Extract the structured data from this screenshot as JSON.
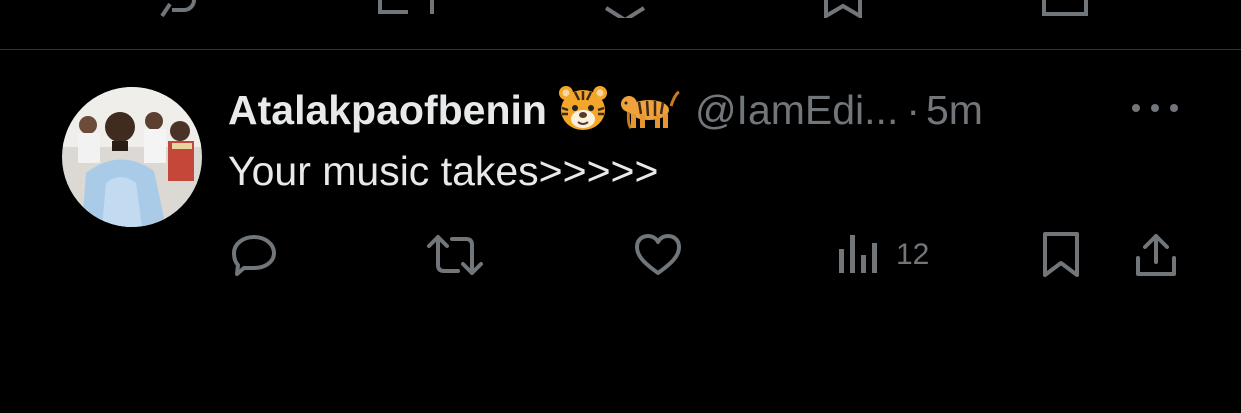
{
  "tweet": {
    "display_name": "Atalakpaofbenin",
    "name_emojis": [
      "tiger-face-emoji",
      "tiger-emoji"
    ],
    "handle": "@IamEdi...",
    "separator": "·",
    "time": "5m",
    "text": "Your music takes>>>>>",
    "actions": {
      "reply_icon": "reply-icon",
      "retweet_icon": "retweet-icon",
      "like_icon": "heart-icon",
      "views_icon": "views-chart-icon",
      "views_count": "12",
      "bookmark_icon": "bookmark-icon",
      "share_icon": "share-icon"
    }
  },
  "colors": {
    "background": "#000000",
    "primary_text": "#e7e9ea",
    "secondary_text": "#71767b",
    "divider": "#2f3336"
  }
}
